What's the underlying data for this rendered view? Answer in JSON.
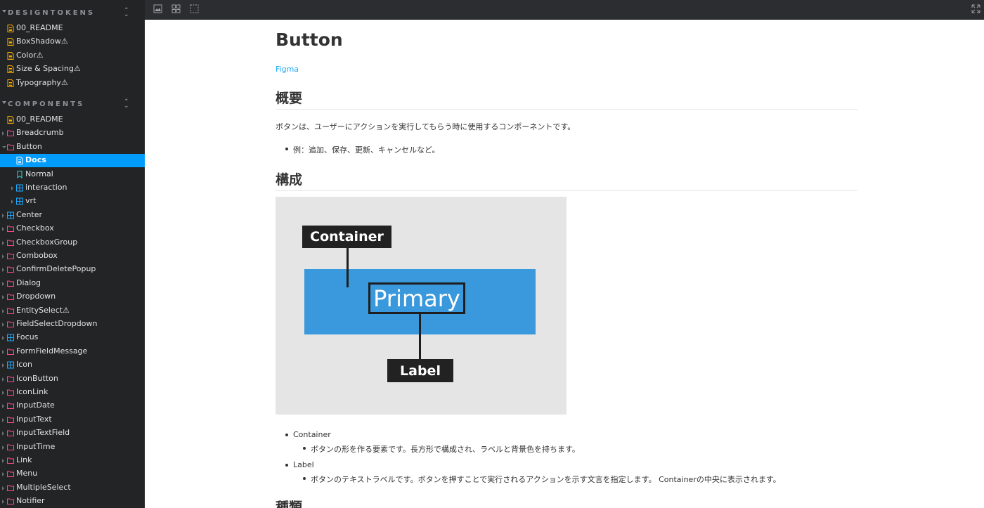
{
  "sidebar": {
    "designtokens": {
      "title": "DESIGNTOKENS",
      "items": [
        {
          "label": "00_README"
        },
        {
          "label": "BoxShadow⚠"
        },
        {
          "label": "Color⚠"
        },
        {
          "label": "Size & Spacing⚠"
        },
        {
          "label": "Typography⚠"
        }
      ]
    },
    "components": {
      "title": "COMPONENTS",
      "items": [
        {
          "label": "00_README",
          "type": "doc"
        },
        {
          "label": "Breadcrumb",
          "type": "folder"
        },
        {
          "label": "Button",
          "type": "folder"
        },
        {
          "label": "Docs",
          "type": "doc"
        },
        {
          "label": "Normal",
          "type": "story"
        },
        {
          "label": "interaction",
          "type": "component"
        },
        {
          "label": "vrt",
          "type": "component"
        },
        {
          "label": "Center",
          "type": "component"
        },
        {
          "label": "Checkbox",
          "type": "folder"
        },
        {
          "label": "CheckboxGroup",
          "type": "folder"
        },
        {
          "label": "Combobox",
          "type": "folder"
        },
        {
          "label": "ConfirmDeletePopup",
          "type": "folder"
        },
        {
          "label": "Dialog",
          "type": "folder"
        },
        {
          "label": "Dropdown",
          "type": "folder"
        },
        {
          "label": "EntitySelect⚠",
          "type": "folder"
        },
        {
          "label": "FieldSelectDropdown",
          "type": "folder"
        },
        {
          "label": "Focus",
          "type": "component"
        },
        {
          "label": "FormFieldMessage",
          "type": "folder"
        },
        {
          "label": "Icon",
          "type": "component"
        },
        {
          "label": "IconButton",
          "type": "folder"
        },
        {
          "label": "IconLink",
          "type": "folder"
        },
        {
          "label": "InputDate",
          "type": "folder"
        },
        {
          "label": "InputText",
          "type": "folder"
        },
        {
          "label": "InputTextField",
          "type": "folder"
        },
        {
          "label": "InputTime",
          "type": "folder"
        },
        {
          "label": "Link",
          "type": "folder"
        },
        {
          "label": "Menu",
          "type": "folder"
        },
        {
          "label": "MultipleSelect",
          "type": "folder"
        },
        {
          "label": "Notifier",
          "type": "folder"
        }
      ]
    }
  },
  "toolbar": {
    "icons": [
      "image-icon",
      "grid-icon",
      "outline-icon",
      "fullscreen-icon"
    ]
  },
  "doc": {
    "title": "Button",
    "figma_link": "Figma",
    "overview_heading": "概要",
    "overview_text": "ボタンは、ユーザーにアクションを実行してもらう時に使用するコンポーネントです。",
    "overview_bullet": "例：追加、保存、更新、キャンセルなど。",
    "structure_heading": "構成",
    "diagram": {
      "container_label": "Container",
      "button_text": "Primary",
      "label_label": "Label"
    },
    "list": [
      {
        "term": "Container",
        "desc": "ボタンの形を作る要素です。長方形で構成され、ラベルと背景色を持ちます。"
      },
      {
        "term": "Label",
        "desc": "ボタンのテキストラベルです。ボタンを押すことで実行されるアクションを示す文言を指定します。 Containerの中央に表示されます。"
      }
    ],
    "next_heading": "種類"
  },
  "colors": {
    "sidebar_bg": "#222426",
    "selected": "#029cfd",
    "folder_icon": "#ff4785",
    "doc_icon": "#ffae00",
    "component_icon": "#1ea7fd",
    "story_icon": "#37d5d3",
    "primary_button": "#3a98dc"
  }
}
